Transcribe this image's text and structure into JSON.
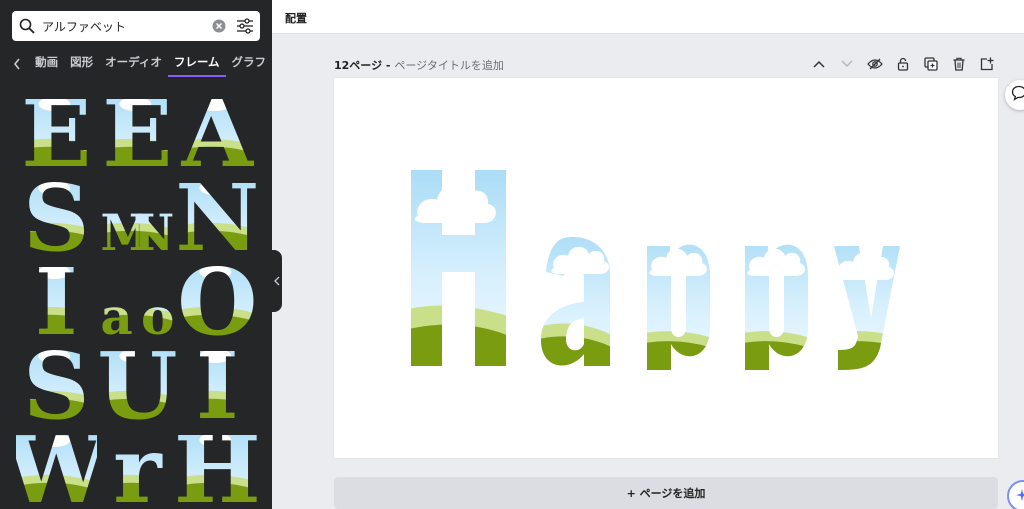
{
  "sidebar": {
    "search": {
      "value": "アルファベット",
      "placeholder": ""
    },
    "tabs": [
      {
        "label": "動画"
      },
      {
        "label": "図形"
      },
      {
        "label": "オーディオ"
      },
      {
        "label": "フレーム",
        "active": true
      },
      {
        "label": "グラフ"
      }
    ],
    "letters": [
      [
        "E",
        "E",
        "A"
      ],
      [
        "S",
        "MN",
        "N"
      ],
      [
        "I",
        "ao",
        "O"
      ],
      [
        "S",
        "U",
        "I"
      ],
      [
        "W",
        "r",
        "H"
      ]
    ]
  },
  "topbar": {
    "title": "配置"
  },
  "page": {
    "number_label": "12ページ",
    "separator": " - ",
    "title_placeholder": "ページタイトルを追加",
    "word": "Happy",
    "add_page_label": "+ ページを追加"
  },
  "colors": {
    "sky_top": "#a9dcf6",
    "sky_bottom": "#e6f6ff",
    "hill_light": "#c9df8a",
    "hill_dark": "#7a9c10",
    "cloud": "#ffffff",
    "accent": "#8b5cf6",
    "sidebar_bg": "#252627"
  },
  "icons": {
    "search": "search-icon",
    "clear": "clear-icon",
    "filter": "filter-icon",
    "back": "chevron-left-icon",
    "actions": [
      "chevron-up-icon",
      "chevron-down-icon",
      "hide-icon",
      "lock-icon",
      "duplicate-icon",
      "delete-icon",
      "add-page-icon"
    ],
    "comment": "comment-icon",
    "magic": "sparkle-icon"
  }
}
